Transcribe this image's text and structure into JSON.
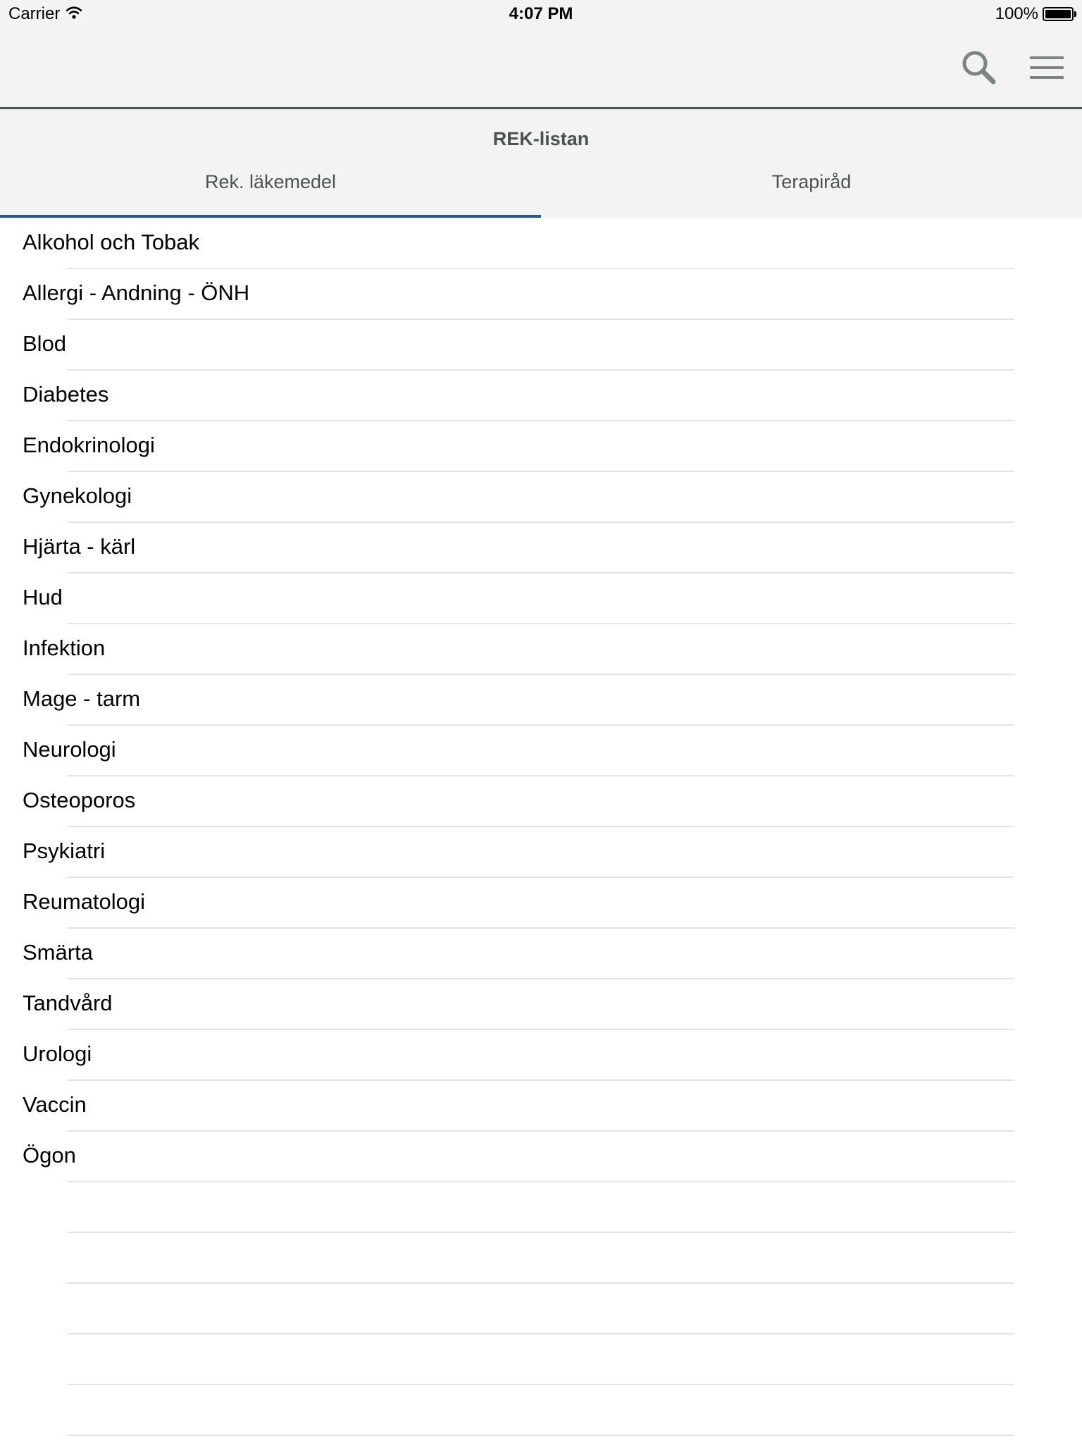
{
  "status_bar": {
    "carrier": "Carrier",
    "time": "4:07 PM",
    "battery": "100%",
    "battery_level": 1.0
  },
  "nav_bar": {
    "search_icon": "search-icon",
    "menu_icon": "hamburger-menu-icon",
    "icon_color": "#7a8584"
  },
  "header": {
    "title": "REK-listan",
    "tabs": [
      {
        "label": "Rek. läkemedel",
        "active": true
      },
      {
        "label": "Terapiråd",
        "active": false
      }
    ],
    "active_color": "#1f5a8a"
  },
  "list": {
    "items": [
      "Alkohol och Tobak",
      "Allergi - Andning - ÖNH",
      "Blod",
      "Diabetes",
      "Endokrinologi",
      "Gynekologi",
      "Hjärta - kärl",
      "Hud",
      "Infektion",
      "Mage - tarm",
      "Neurologi",
      "Osteoporos",
      "Psykiatri",
      "Reumatologi",
      "Smärta",
      "Tandvård",
      "Urologi",
      "Vaccin",
      "Ögon",
      "",
      "",
      "",
      "",
      ""
    ]
  }
}
